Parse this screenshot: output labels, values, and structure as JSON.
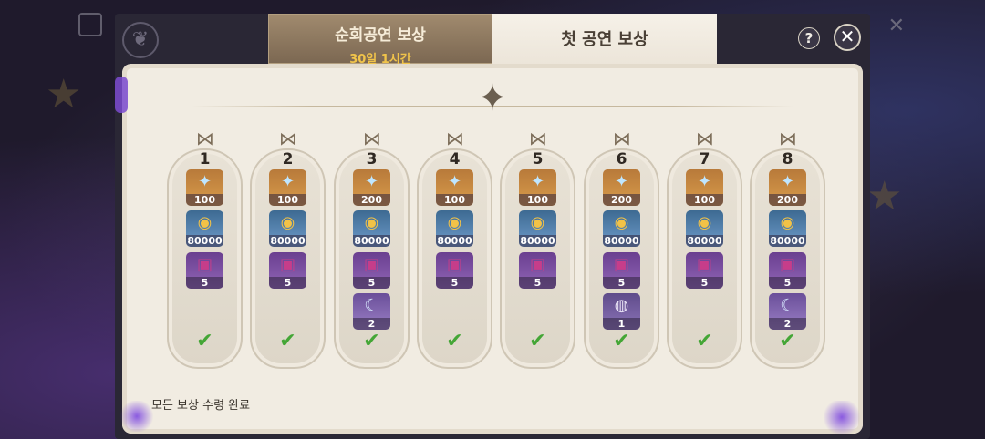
{
  "tabs": {
    "tour": {
      "label": "순회공연 보상",
      "timer": "30일 1시간"
    },
    "first": {
      "label": "첫 공연 보상"
    }
  },
  "controls": {
    "help": "?",
    "close": "✕"
  },
  "footer": {
    "status": "모든 보상 수령 완료"
  },
  "days": [
    {
      "day": "1",
      "claimed": true,
      "rewards": [
        {
          "type": "primogem",
          "icon": "primogem-icon",
          "count": "100"
        },
        {
          "type": "mora",
          "icon": "mora-icon",
          "count": "80000"
        },
        {
          "type": "talent-book",
          "icon": "book-icon",
          "count": "5"
        }
      ]
    },
    {
      "day": "2",
      "claimed": true,
      "rewards": [
        {
          "type": "primogem",
          "icon": "primogem-icon",
          "count": "100"
        },
        {
          "type": "mora",
          "icon": "mora-icon",
          "count": "80000"
        },
        {
          "type": "talent-book",
          "icon": "book-icon",
          "count": "5"
        }
      ]
    },
    {
      "day": "3",
      "claimed": true,
      "rewards": [
        {
          "type": "primogem",
          "icon": "primogem-icon",
          "count": "200"
        },
        {
          "type": "mora",
          "icon": "mora-icon",
          "count": "80000"
        },
        {
          "type": "talent-book",
          "icon": "book-icon",
          "count": "5"
        },
        {
          "type": "fate",
          "icon": "fate-icon",
          "count": "2"
        }
      ]
    },
    {
      "day": "4",
      "claimed": true,
      "rewards": [
        {
          "type": "primogem",
          "icon": "primogem-icon",
          "count": "100"
        },
        {
          "type": "mora",
          "icon": "mora-icon",
          "count": "80000"
        },
        {
          "type": "talent-book",
          "icon": "book-icon",
          "count": "5"
        }
      ]
    },
    {
      "day": "5",
      "claimed": true,
      "rewards": [
        {
          "type": "primogem",
          "icon": "primogem-icon",
          "count": "100"
        },
        {
          "type": "mora",
          "icon": "mora-icon",
          "count": "80000"
        },
        {
          "type": "talent-book",
          "icon": "book-icon",
          "count": "5"
        }
      ]
    },
    {
      "day": "6",
      "claimed": true,
      "rewards": [
        {
          "type": "primogem",
          "icon": "primogem-icon",
          "count": "200"
        },
        {
          "type": "mora",
          "icon": "mora-icon",
          "count": "80000"
        },
        {
          "type": "talent-book",
          "icon": "book-icon",
          "count": "5"
        },
        {
          "type": "furnishing",
          "icon": "drum-icon",
          "count": "1"
        }
      ]
    },
    {
      "day": "7",
      "claimed": true,
      "rewards": [
        {
          "type": "primogem",
          "icon": "primogem-icon",
          "count": "100"
        },
        {
          "type": "mora",
          "icon": "mora-icon",
          "count": "80000"
        },
        {
          "type": "talent-book",
          "icon": "book-icon",
          "count": "5"
        }
      ]
    },
    {
      "day": "8",
      "claimed": true,
      "rewards": [
        {
          "type": "primogem",
          "icon": "primogem-icon",
          "count": "200"
        },
        {
          "type": "mora",
          "icon": "mora-icon",
          "count": "80000"
        },
        {
          "type": "talent-book",
          "icon": "book-icon",
          "count": "5"
        },
        {
          "type": "fate",
          "icon": "fate-icon",
          "count": "2"
        }
      ]
    }
  ],
  "colors": {
    "accent_check": "#44a636",
    "tab_timer": "#f1c44a",
    "panel_bg": "#f1ece2"
  }
}
